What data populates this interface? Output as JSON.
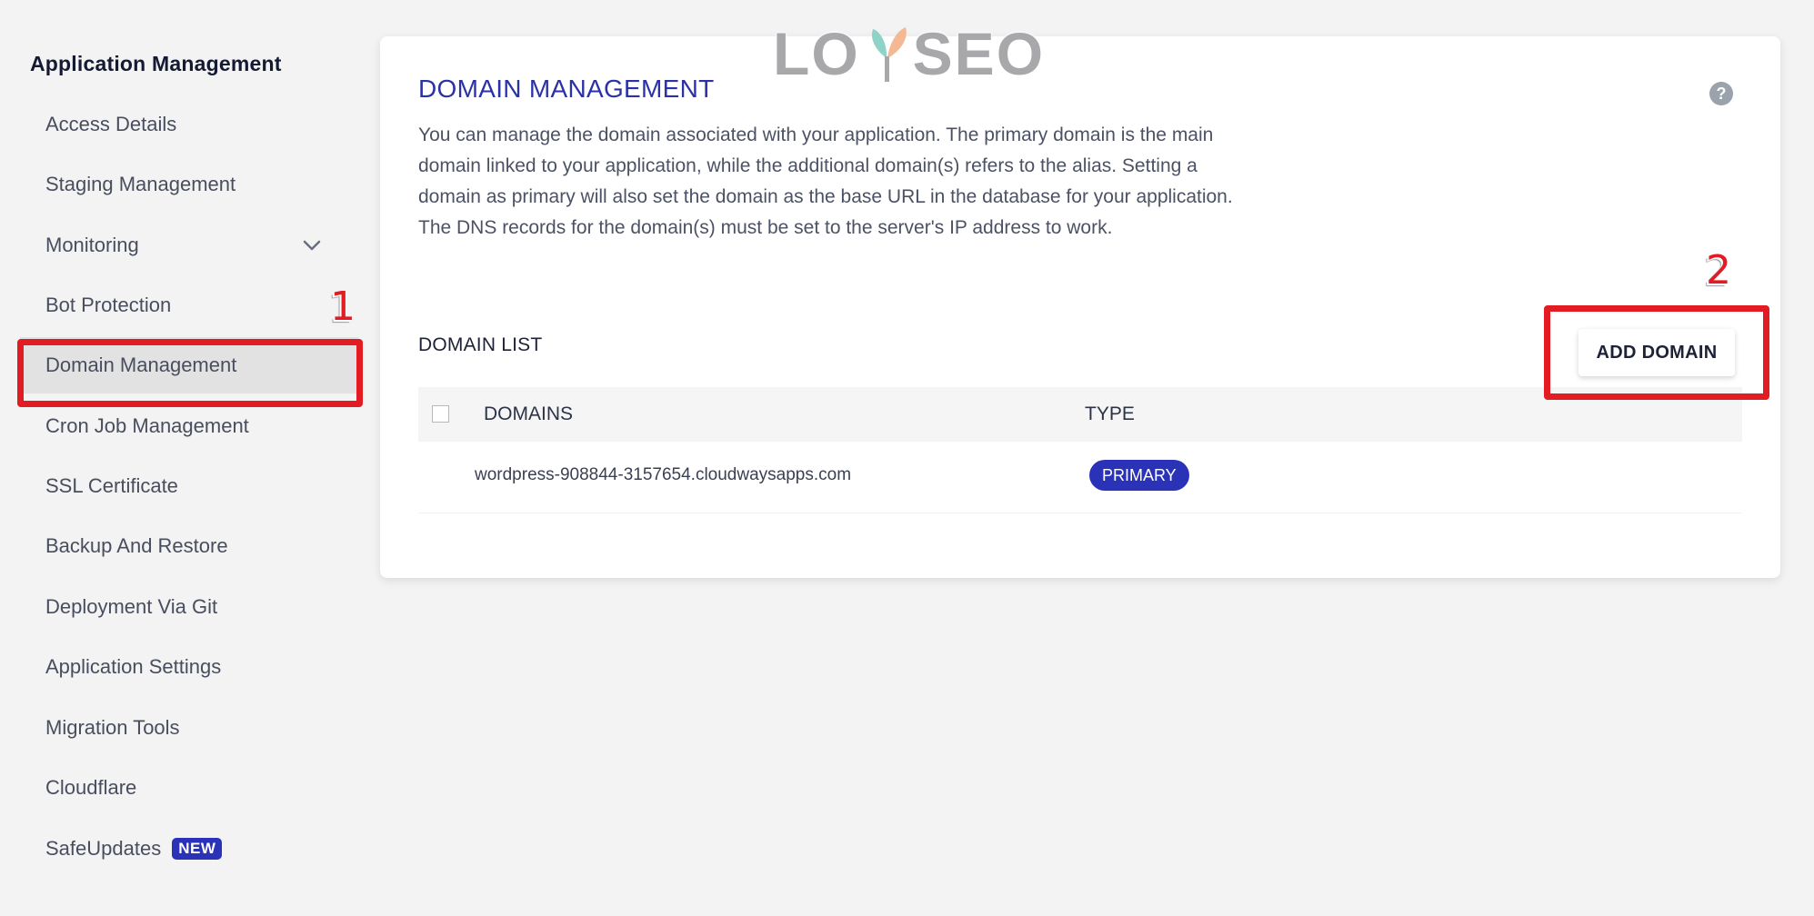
{
  "sidebar": {
    "title": "Application Management",
    "items": [
      {
        "label": "Access Details"
      },
      {
        "label": "Staging Management"
      },
      {
        "label": "Monitoring",
        "icon": "chevron-down-icon"
      },
      {
        "label": "Bot Protection"
      },
      {
        "label": "Domain Management",
        "active": true
      },
      {
        "label": "Cron Job Management"
      },
      {
        "label": "SSL Certificate"
      },
      {
        "label": "Backup And Restore"
      },
      {
        "label": "Deployment Via Git"
      },
      {
        "label": "Application Settings"
      },
      {
        "label": "Migration Tools"
      },
      {
        "label": "Cloudflare"
      },
      {
        "label": "SafeUpdates",
        "badge": "NEW"
      }
    ]
  },
  "main": {
    "title": "DOMAIN MANAGEMENT",
    "help_icon": "question-circle-icon",
    "description": "You can manage the domain associated with your application. The primary domain is the main domain linked to your application, while the additional domain(s) refers to the alias. Setting a domain as primary will also set the domain as the base URL in the database for your application. The DNS records for the domain(s) must be set to the server's IP address to work.",
    "domain_list": {
      "title": "DOMAIN LIST",
      "add_button": "ADD DOMAIN",
      "columns": [
        "DOMAINS",
        "TYPE"
      ],
      "rows": [
        {
          "domain": "wordpress-908844-3157654.cloudwaysapps.com",
          "type": "PRIMARY"
        }
      ]
    }
  },
  "annotations": {
    "step1": "1",
    "step2": "2"
  },
  "watermark": {
    "left": "LO",
    "right": "SEO"
  },
  "colors": {
    "accent": "#2a33b8",
    "annotation": "#e31b23",
    "background": "#f3f3f4"
  }
}
